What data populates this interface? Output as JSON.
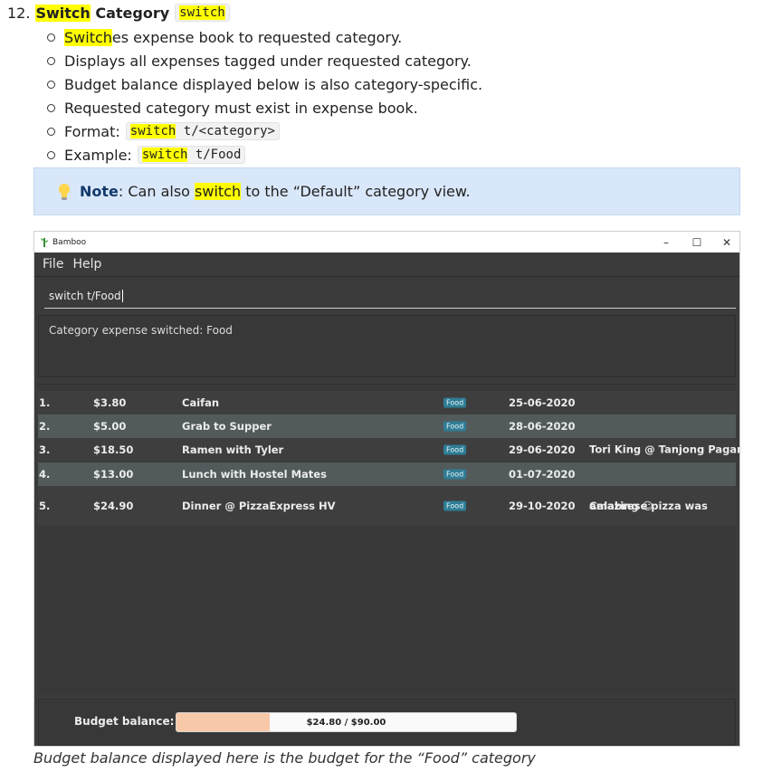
{
  "doc": {
    "number": "12.",
    "title_hl": "Switch",
    "title_rest": " Category",
    "title_code": "switch",
    "bullets": {
      "b1_hl": "Switch",
      "b1_rest": "es expense book to requested category.",
      "b2": "Displays all expenses tagged under requested category.",
      "b3": "Budget balance displayed below is also category-specific.",
      "b4": "Requested category must exist in expense book.",
      "format_label": "Format:",
      "format_cmd": "switch",
      "format_arg": " t/<category>",
      "example_label": "Example:",
      "example_cmd": "switch",
      "example_arg": " t/Food"
    },
    "note": {
      "label": "Note",
      "pre": ": Can also ",
      "hl": "switch",
      "post": " to the “Default” category view."
    },
    "caption": "Budget balance displayed here is the budget for the “Food” category"
  },
  "app": {
    "title": "Bamboo",
    "controls": {
      "minimize": "–",
      "maximize": "☐",
      "close": "✕"
    },
    "menu": [
      "File",
      "Help"
    ],
    "command_input": "switch t/Food",
    "result_text": "Category expense switched:  Food",
    "expenses": [
      {
        "index": "1.",
        "amount": "$3.80",
        "name": "Caifan",
        "tag": "Food",
        "date": "25-06-2020",
        "remark": ""
      },
      {
        "index": "2.",
        "amount": "$5.00",
        "name": "Grab to Supper",
        "tag": "Food",
        "date": "28-06-2020",
        "remark": ""
      },
      {
        "index": "3.",
        "amount": "$18.50",
        "name": "Ramen with Tyler",
        "tag": "Food",
        "date": "29-06-2020",
        "remark": "Tori King @ Tanjong Pagar"
      },
      {
        "index": "4.",
        "amount": "$13.00",
        "name": "Lunch with Hostel Mates",
        "tag": "Food",
        "date": "01-07-2020",
        "remark": ""
      },
      {
        "index": "5.",
        "amount": "$24.90",
        "name": "Dinner @ PizzaExpress HV",
        "tag": "Food",
        "date": "29-10-2020",
        "remark_line1": "Calabrese pizza was",
        "remark_line2": "amazing ☺"
      }
    ],
    "budget": {
      "label": "Budget balance:",
      "text": "$24.80 / $90.00",
      "fraction": 0.2756
    }
  },
  "colors": {
    "highlight": "#ffff00",
    "note_bg": "#d9e7fa",
    "app_bg": "#3b3b3b",
    "row_alt": "#525a5c",
    "tag_bg": "#2f7d95",
    "budget_fill": "#f8c9a8"
  }
}
